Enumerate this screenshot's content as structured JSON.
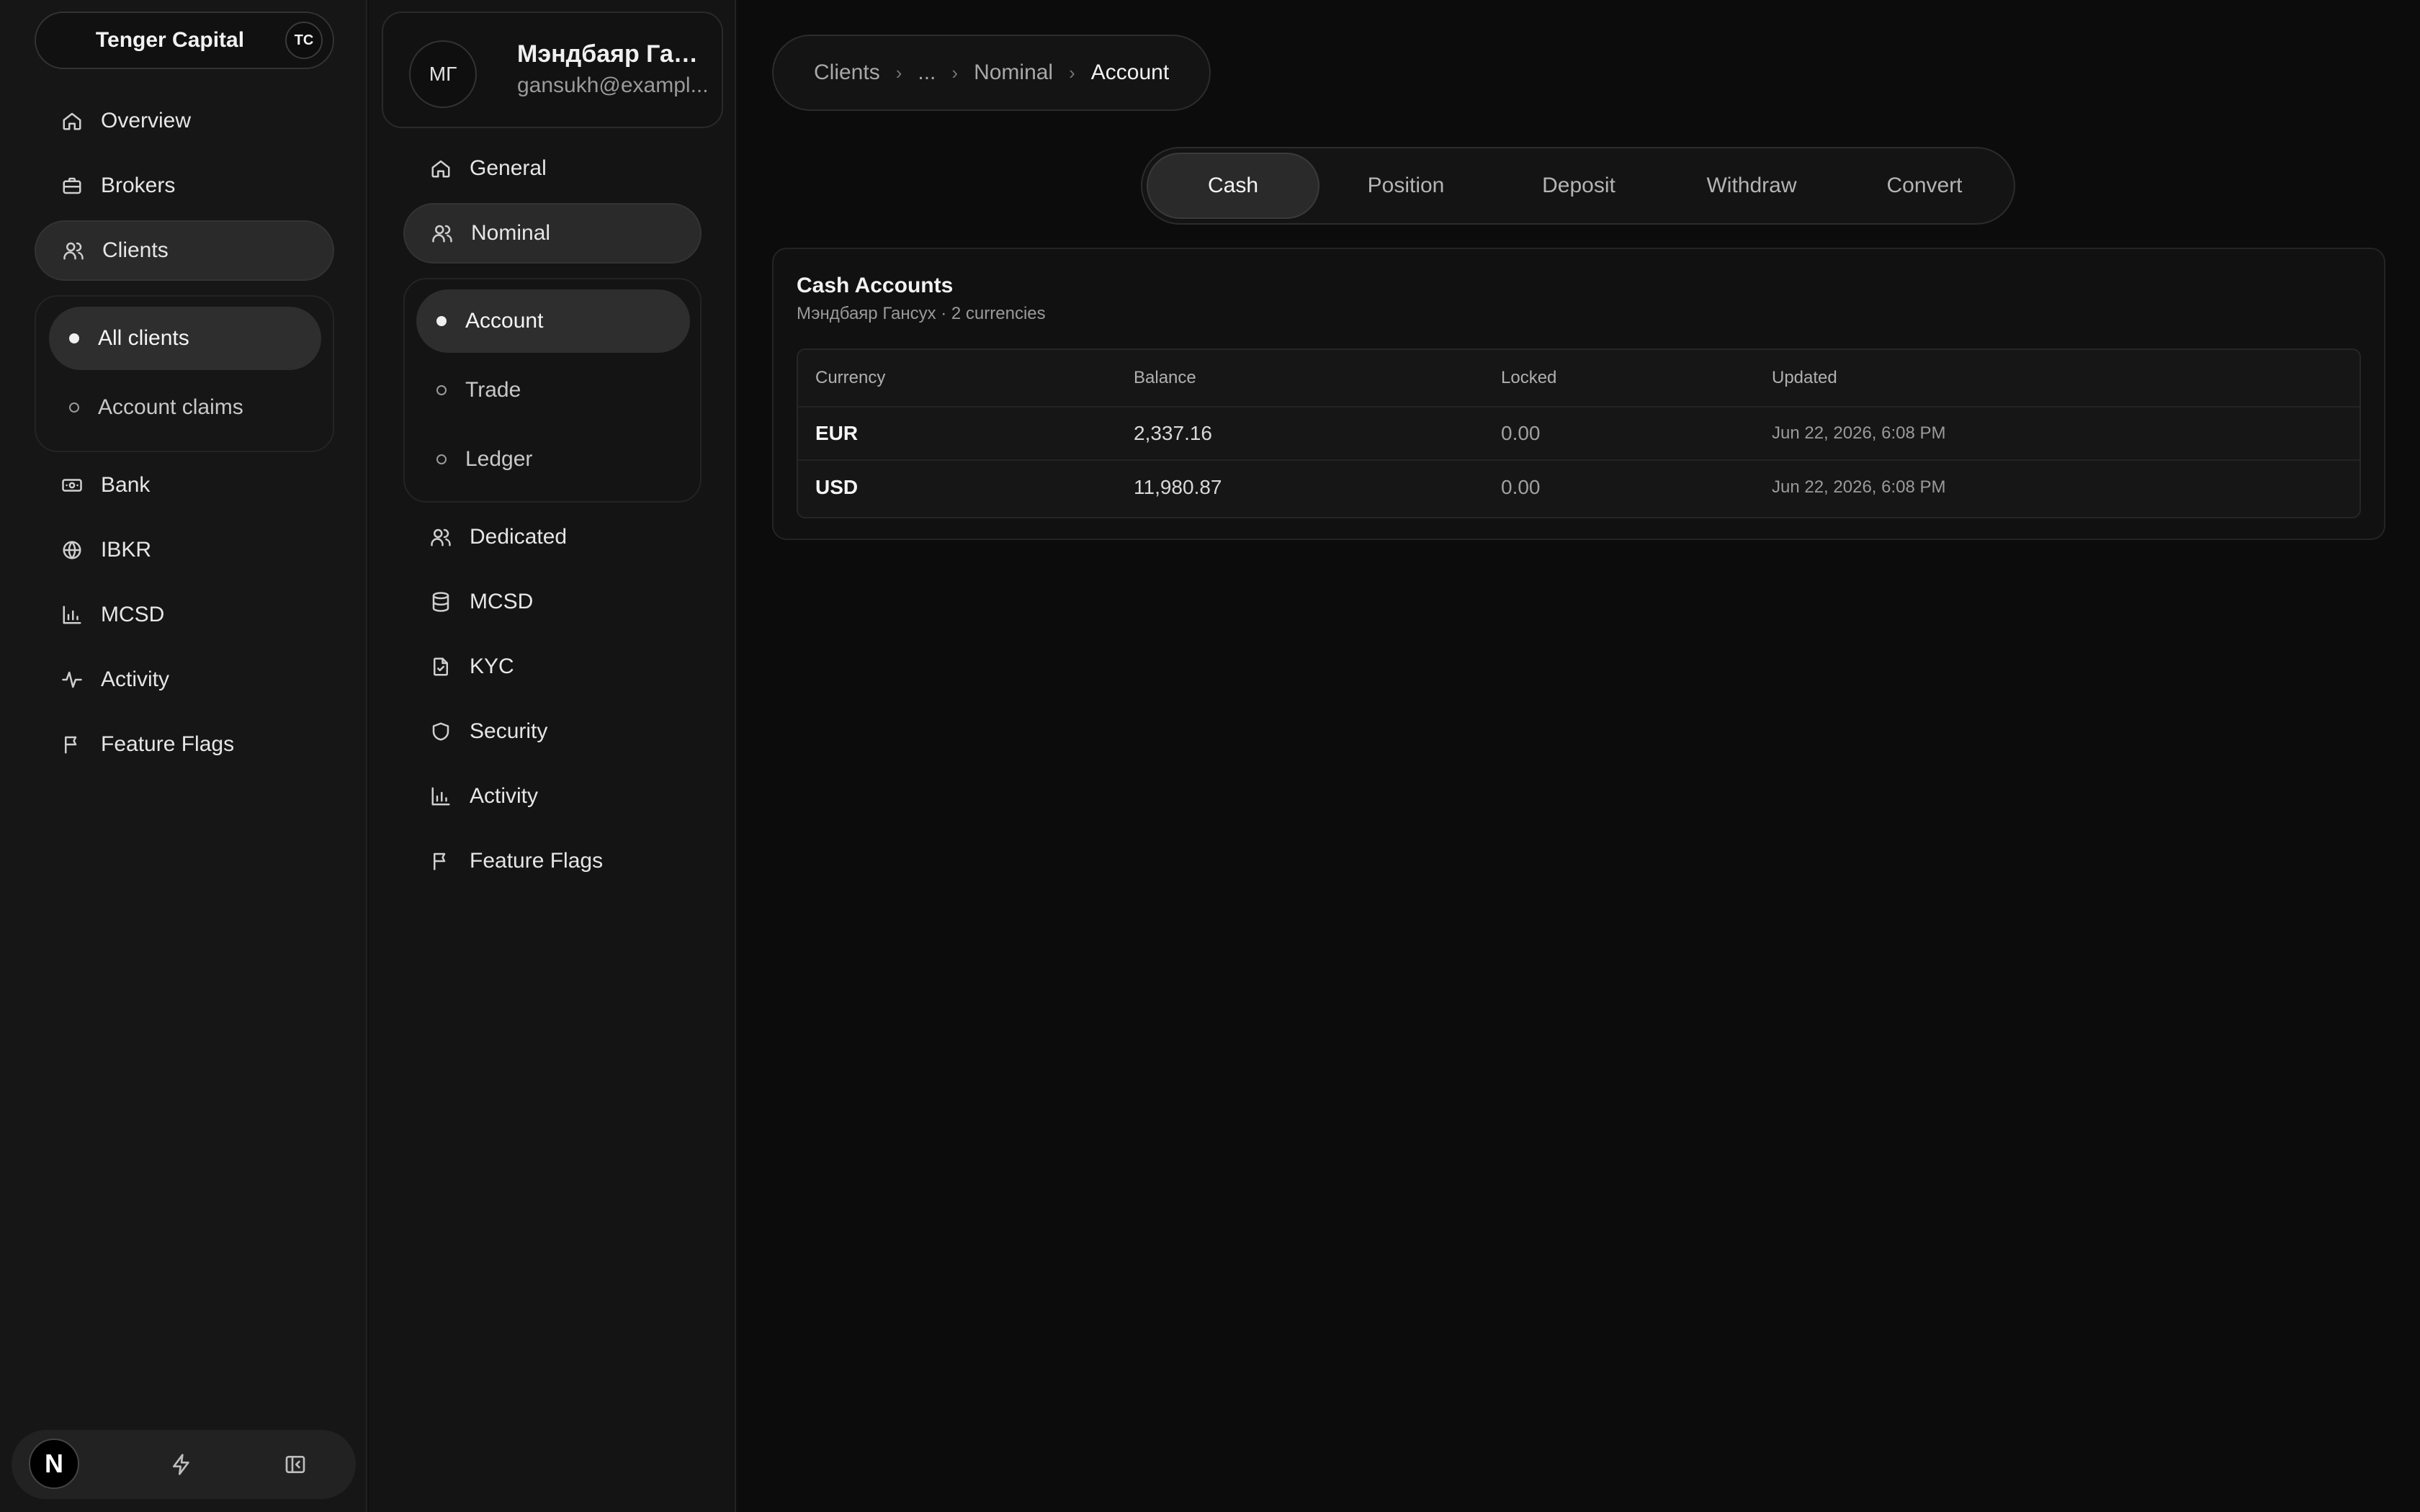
{
  "sidebar": {
    "org_name": "Tenger Capital",
    "org_badge": "TC",
    "items": [
      {
        "label": "Overview",
        "icon": "home-icon"
      },
      {
        "label": "Brokers",
        "icon": "briefcase-icon"
      },
      {
        "label": "Clients",
        "icon": "users-icon",
        "active": true
      },
      {
        "label": "Bank",
        "icon": "banknote-icon"
      },
      {
        "label": "IBKR",
        "icon": "globe-icon"
      },
      {
        "label": "MCSD",
        "icon": "bar-chart-icon"
      },
      {
        "label": "Activity",
        "icon": "activity-icon"
      },
      {
        "label": "Feature Flags",
        "icon": "flag-icon"
      }
    ],
    "sub_items": [
      {
        "label": "All clients",
        "active": true
      },
      {
        "label": "Account claims"
      }
    ],
    "footer": {
      "logo": "N"
    }
  },
  "client_nav": {
    "avatar": "МГ",
    "name": "Мэндбаяр Ганс...",
    "email": "gansukh@exampl...",
    "items": [
      {
        "label": "General",
        "icon": "home-icon"
      },
      {
        "label": "Nominal",
        "icon": "users-icon",
        "active": true
      },
      {
        "label": "Dedicated",
        "icon": "users-icon"
      },
      {
        "label": "MCSD",
        "icon": "database-icon"
      },
      {
        "label": "KYC",
        "icon": "file-icon"
      },
      {
        "label": "Security",
        "icon": "shield-icon"
      },
      {
        "label": "Activity",
        "icon": "bar-chart-icon"
      },
      {
        "label": "Feature Flags",
        "icon": "flag-icon"
      }
    ],
    "sub_items": [
      {
        "label": "Account",
        "active": true
      },
      {
        "label": "Trade"
      },
      {
        "label": "Ledger"
      }
    ]
  },
  "breadcrumb": {
    "items": [
      "Clients",
      "...",
      "Nominal"
    ],
    "current": "Account"
  },
  "tabs": [
    {
      "label": "Cash",
      "active": true
    },
    {
      "label": "Position"
    },
    {
      "label": "Deposit"
    },
    {
      "label": "Withdraw"
    },
    {
      "label": "Convert"
    }
  ],
  "card": {
    "title": "Cash Accounts",
    "subtitle": "Мэндбаяр Гансух · 2 currencies",
    "columns": [
      "Currency",
      "Balance",
      "Locked",
      "Updated"
    ],
    "rows": [
      {
        "currency": "EUR",
        "balance": "2,337.16",
        "locked": "0.00",
        "updated": "Jun 22, 2026, 6:08 PM"
      },
      {
        "currency": "USD",
        "balance": "11,980.87",
        "locked": "0.00",
        "updated": "Jun 22, 2026, 6:08 PM"
      }
    ]
  }
}
